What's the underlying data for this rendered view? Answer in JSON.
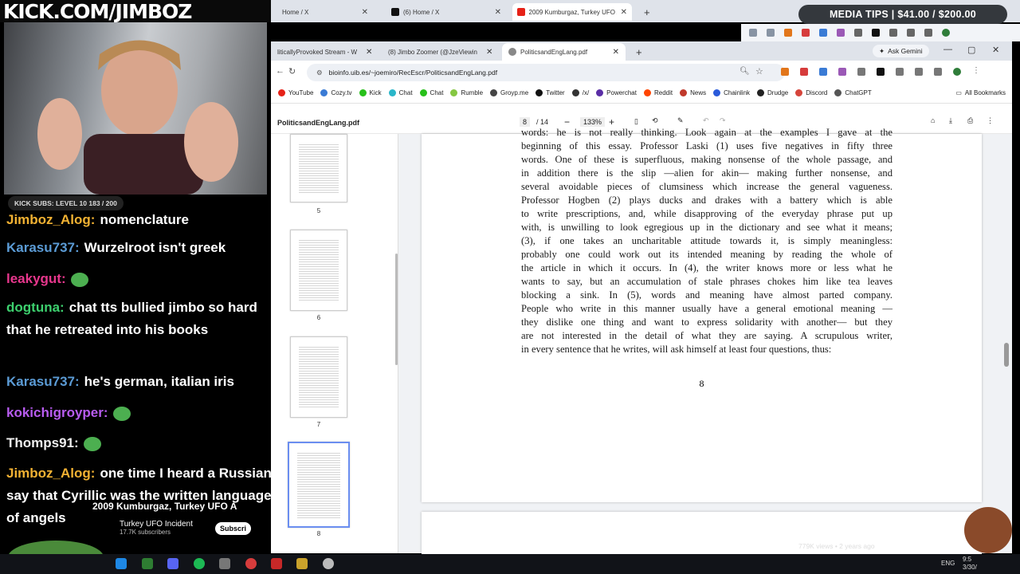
{
  "stream": {
    "banner": "KICK.COM/JIMBOZ",
    "subs_bar": "KICK SUBS: LEVEL 10 183 / 200",
    "media_tips": "MEDIA  TIPS | $41.00 / $200.00"
  },
  "back_window": {
    "tabs": [
      {
        "label": "Home / X"
      },
      {
        "label": "(6) Home / X"
      },
      {
        "label": "2009 Kumburgaz, Turkey UFO A"
      }
    ]
  },
  "browser": {
    "tabs": [
      {
        "label": "liticallyProvoked Stream - W"
      },
      {
        "label": "(8) Jimbo Zoomer (@JzeViewin"
      },
      {
        "label": "PoliticsandEngLang.pdf"
      }
    ],
    "ask_gemini": "Ask Gemini",
    "url": "bioinfo.uib.es/~joemiro/RecEscr/PoliticsandEngLang.pdf",
    "bookmarks": [
      {
        "label": "YouTube",
        "color": "#e62117"
      },
      {
        "label": "Cozy.tv",
        "color": "#3a7bd5"
      },
      {
        "label": "Kick",
        "color": "#27c01a"
      },
      {
        "label": "Chat",
        "color": "#2ab6c9"
      },
      {
        "label": "Chat",
        "color": "#27c01a"
      },
      {
        "label": "Rumble",
        "color": "#85c742"
      },
      {
        "label": "Groyp.me",
        "color": "#444"
      },
      {
        "label": "Twitter",
        "color": "#111"
      },
      {
        "label": "/x/",
        "color": "#333"
      },
      {
        "label": "Powerchat",
        "color": "#5a2ea6"
      },
      {
        "label": "Reddit",
        "color": "#ff4500"
      },
      {
        "label": "News",
        "color": "#c0392b"
      },
      {
        "label": "Chainlink",
        "color": "#2a5ada"
      },
      {
        "label": "Drudge",
        "color": "#222"
      },
      {
        "label": "Discord",
        "color": "#d6453b"
      },
      {
        "label": "ChatGPT",
        "color": "#555"
      }
    ],
    "all_bookmarks": "All Bookmarks"
  },
  "pdf": {
    "title": "PoliticsandEngLang.pdf",
    "page": "8",
    "total": "/ 14",
    "zoom": "133%",
    "thumb_labels": [
      "5",
      "6",
      "7",
      "8"
    ],
    "lines": [
      "words: he is not really thinking. Look again at the examples I gave at the",
      "beginning of this essay.  Professor Laski (1) uses five negatives in fifty three",
      "words.  One of these is superfluous, making nonsense of the whole passage, and",
      "in addition there is the slip —alien for akin— making further nonsense, and",
      "several avoidable pieces of clumsiness which increase the general vagueness.",
      "Professor Hogben (2) plays ducks and drakes with a battery which is able",
      "to write prescriptions, and, while disapproving of the everyday phrase put up",
      "with, is unwilling to look egregious up in the dictionary and see what it means;",
      "(3), if one takes an uncharitable attitude towards it, is simply meaningless:",
      "probably one could work out its intended meaning by reading the whole of",
      "the article in which it occurs.  In (4), the writer knows more or less what he",
      "wants to say, but an accumulation of stale phrases chokes him like tea leaves",
      "blocking a sink.  In (5), words and meaning have almost parted company.",
      "People who write in this manner usually have a general emotional meaning —",
      "they dislike one thing and want to express solidarity with another— but they",
      "are not interested in the detail of what they are saying.  A scrupulous writer,",
      "in every sentence that he writes, will ask himself at least four questions, thus:"
    ],
    "page_number": "8"
  },
  "chat": [
    {
      "user": "Jimboz_Alog:",
      "text": "nomenclature",
      "color": "#f2b233"
    },
    {
      "user": "Karasu737:",
      "text": "Wurzelroot isn't greek",
      "color": "#5b9bd5"
    },
    {
      "user": "leakygut:",
      "text": "",
      "color": "#e8378d"
    },
    {
      "user": "dogtuna:",
      "text": "chat tts bullied jimbo so hard that he retreated into his books",
      "color": "#3dd06e"
    },
    {
      "user": "Karasu737:",
      "text": "he's german, italian iris",
      "color": "#5b9bd5"
    },
    {
      "user": "kokichigroyper:",
      "text": "",
      "color": "#b85cf0"
    },
    {
      "user": "Thomps91:",
      "text": "",
      "color": "#f0f0f0"
    },
    {
      "user": "Jimboz_Alog:",
      "text": "one time I heard a Russian say that Cyrillic was the written language of angels",
      "color": "#f2b233"
    }
  ],
  "youtube": {
    "title": "2009 Kumburgaz, Turkey UFO A",
    "channel": "Turkey UFO Incident",
    "subs": "17.7K subscribers",
    "subscribe": "Subscri",
    "meta": "779K views • 2 years ago"
  },
  "taskbar": {
    "lang": "ENG",
    "time": "9:5",
    "date": "3/30/"
  }
}
